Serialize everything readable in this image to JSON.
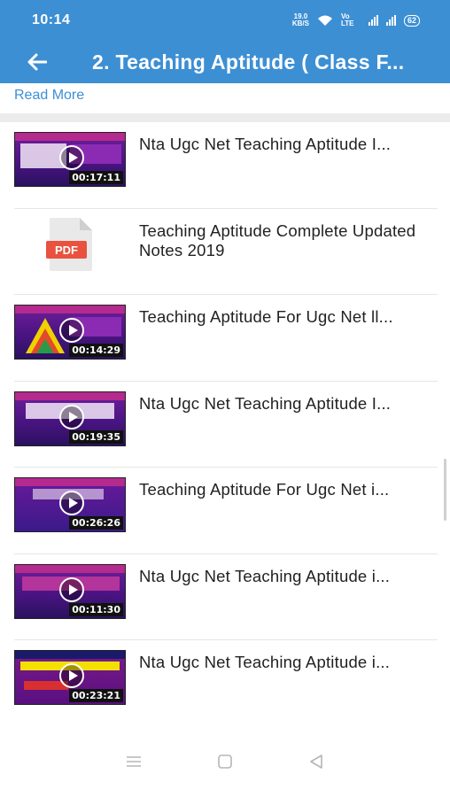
{
  "status_bar": {
    "time": "10:14",
    "speed_value": "19.0",
    "speed_unit": "KB/S",
    "network": "Vo LTE",
    "battery": "62"
  },
  "app_bar": {
    "title": "2. Teaching Aptitude ( Class F..."
  },
  "read_more": "Read More",
  "items": [
    {
      "type": "video",
      "title": "Nta Ugc Net Teaching Aptitude I...",
      "duration": "00:17:11"
    },
    {
      "type": "pdf",
      "title": "Teaching Aptitude Complete Updated Notes 2019",
      "icon_label": "PDF"
    },
    {
      "type": "video",
      "title": "Teaching Aptitude For Ugc Net ll...",
      "duration": "00:14:29"
    },
    {
      "type": "video",
      "title": "Nta Ugc Net Teaching Aptitude I...",
      "duration": "00:19:35"
    },
    {
      "type": "video",
      "title": "Teaching Aptitude For Ugc Net i...",
      "duration": "00:26:26"
    },
    {
      "type": "video",
      "title": "Nta Ugc Net Teaching Aptitude i...",
      "duration": "00:11:30"
    },
    {
      "type": "video",
      "title": "Nta Ugc Net Teaching Aptitude i...",
      "duration": "00:23:21"
    }
  ],
  "colors": {
    "primary": "#3d8fd4",
    "pdf_red": "#e8523f"
  },
  "icons": [
    "back-arrow-icon",
    "wifi-icon",
    "signal-icon",
    "battery-icon",
    "play-icon",
    "pdf-icon",
    "menu-icon",
    "home-icon",
    "back-icon"
  ]
}
